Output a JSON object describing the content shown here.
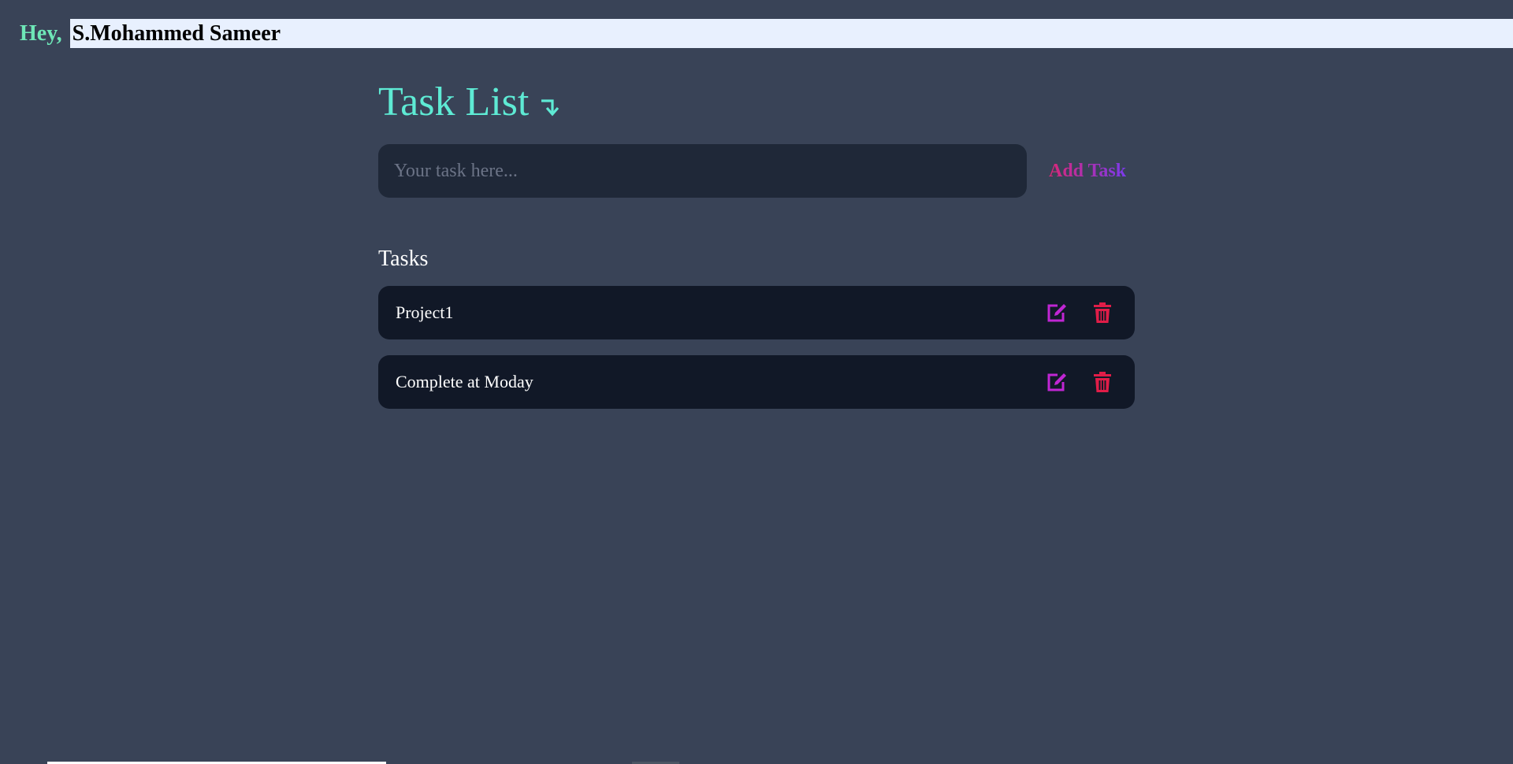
{
  "header": {
    "greeting": "Hey,",
    "user_name": "S.Mohammed Sameer"
  },
  "main": {
    "title": "Task List",
    "title_icon": "arrow-down-right-icon",
    "task_input": {
      "placeholder": "Your task here...",
      "value": ""
    },
    "add_button_label": "Add Task",
    "tasks_heading": "Tasks",
    "tasks": [
      {
        "text": "Project1"
      },
      {
        "text": "Complete at Moday"
      }
    ]
  },
  "colors": {
    "background": "#394357",
    "accent_title": "#5eead4",
    "greeting": "#6ee7b7",
    "edit_icon": "#c026d3",
    "delete_icon": "#e11d48"
  }
}
